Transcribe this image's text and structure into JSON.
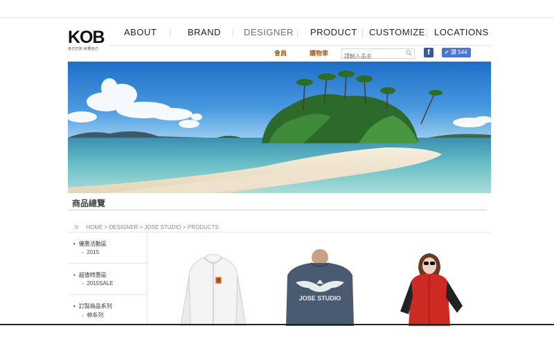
{
  "logo": {
    "text": "KOB",
    "tagline": "自己打扮 就要自己"
  },
  "nav": {
    "items": [
      {
        "label": "ABOUT"
      },
      {
        "label": "BRAND"
      },
      {
        "label": "DESIGNER"
      },
      {
        "label": "PRODUCT"
      },
      {
        "label": "CUSTOMIZE"
      },
      {
        "label": "LOCATIONS"
      }
    ],
    "active": "DESIGNER"
  },
  "utility": {
    "member": "會員",
    "cart": "購物車",
    "search_placeholder": "請輸入品名",
    "facebook_letter": "f",
    "like_label": "讚 544"
  },
  "page": {
    "title": "商品總覽"
  },
  "breadcrumb": {
    "text": "HOME > DESIGNER > JOSE STUDIO > PRODUCTS"
  },
  "sidebar": {
    "groups": [
      {
        "title": "優惠活動區",
        "sub": "2015"
      },
      {
        "title": "超值特惠區",
        "sub": "2015SALE"
      },
      {
        "title": "訂製商品系列",
        "sub": "棉系列"
      }
    ]
  },
  "products": [
    {
      "name": "white-zip-hoodie"
    },
    {
      "name": "jose-studio-eagle-sweater",
      "print_text": "JOSE STUDIO"
    },
    {
      "name": "red-hooded-jacket"
    }
  ],
  "colors": {
    "nav_active": "#66708a",
    "util_link": "#a0622a",
    "facebook": "#3b5998",
    "like": "#4a76d4"
  }
}
